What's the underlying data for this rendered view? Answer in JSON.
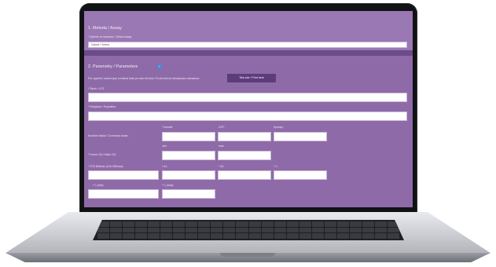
{
  "section_method": {
    "title": "1. Metoda / Assay",
    "instruction": "* Vyberte ze seznamu / Select assay:",
    "select_value": "Vybrat / Select"
  },
  "section_parameters": {
    "title": "2. Parametry / Parameters",
    "help_icon": "info-icon",
    "note": "Pro vyplnění hodnot jsou uvedena data pro toto kit číslo. Pro lot test do aktualizace zobrazena:",
    "button_label": "Tisk zde / Print here",
    "lot_label": "* Šarže / LOT:",
    "expiration_label": "* Exspirace / Expiration:",
    "correction_factor_label": "Korekční faktor / Correction factor:",
    "col_labels": [
      "* Istnovit:",
      "CSF:",
      "Synoviy:"
    ],
    "ratio_label": "* Poměr OD / Ratio OD:",
    "ratio_cols": [
      "min:",
      "max:"
    ],
    "std_label": "* STD B/Bmax (CAL B/Bmax):",
    "std_cols": [
      "* A1:",
      "* A2:",
      "* C:"
    ],
    "c_min_label": "* C (min):",
    "c_max_label": "* C (max):"
  },
  "colors": {
    "panel": "#8f6aa8",
    "divider": "#6b4b8a",
    "button": "#5d3c7c"
  }
}
